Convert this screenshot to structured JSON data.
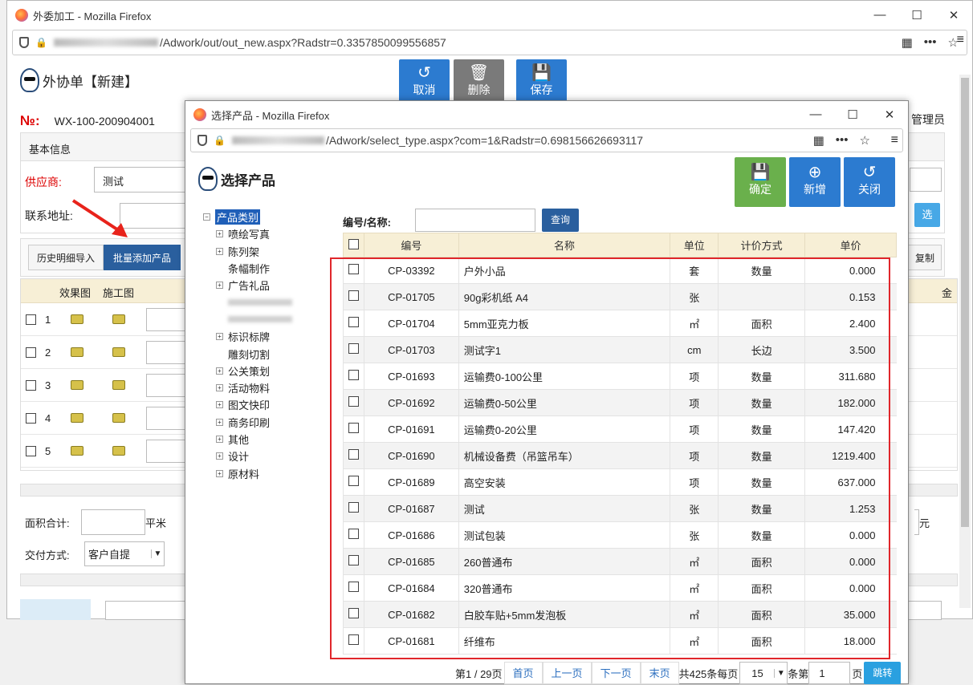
{
  "outer": {
    "window_title": "外委加工 - Mozilla Firefox",
    "url_visible": "/Adwork/out/out_new.aspx?Radstr=0.3357850099556857",
    "page_title": "外协单【新建】",
    "no_label": "№:",
    "no_value": "WX-100-200904001",
    "toolbar": {
      "cancel": "取消",
      "delete": "删除",
      "save": "保存"
    },
    "user_label": "管理员",
    "basic_info": "基本信息",
    "supplier_label": "供应商:",
    "supplier_value": "测试",
    "address_label": "联系地址:",
    "pick_button": "选",
    "tabs": {
      "history_import": "历史明细导入",
      "batch_add": "批量添加产品",
      "copy": "复制"
    },
    "detail_headers": {
      "effect_img": "效果图",
      "work_img": "施工图",
      "amount_partial": "金"
    },
    "rows": [
      "1",
      "2",
      "3",
      "4",
      "5"
    ],
    "area_total_label": "面积合计:",
    "area_unit": "平米",
    "currency_unit": "元",
    "delivery_label": "交付方式:",
    "delivery_value": "客户自提"
  },
  "popup": {
    "window_title": "选择产品 - Mozilla Firefox",
    "url_visible": "/Adwork/select_type.aspx?com=1&Radstr=0.698156626693117",
    "page_title": "选择产品",
    "buttons": {
      "confirm": "确定",
      "add": "新增",
      "close": "关闭"
    },
    "search_label": "编号/名称:",
    "search_value": "",
    "query_button": "查询",
    "tree_root": "产品类别",
    "tree": [
      {
        "label": "喷绘写真",
        "expandable": true
      },
      {
        "label": "陈列架",
        "expandable": true
      },
      {
        "label": "条幅制作",
        "expandable": false
      },
      {
        "label": "广告礼品",
        "expandable": true
      },
      {
        "label": "",
        "expandable": false
      },
      {
        "label": "",
        "expandable": false
      },
      {
        "label": "标识标牌",
        "expandable": true
      },
      {
        "label": "雕刻切割",
        "expandable": false
      },
      {
        "label": "公关策划",
        "expandable": true
      },
      {
        "label": "活动物料",
        "expandable": true
      },
      {
        "label": "图文快印",
        "expandable": true
      },
      {
        "label": "商务印刷",
        "expandable": true
      },
      {
        "label": "其他",
        "expandable": true
      },
      {
        "label": "设计",
        "expandable": true
      },
      {
        "label": "原材料",
        "expandable": true
      }
    ],
    "columns": [
      "编号",
      "名称",
      "单位",
      "计价方式",
      "单价"
    ],
    "products": [
      {
        "code": "CP-03392",
        "name": "户外小品",
        "unit": "套",
        "pricing": "数量",
        "price": "0.000"
      },
      {
        "code": "CP-01705",
        "name": "90g彩机纸 A4",
        "unit": "张",
        "pricing": "",
        "price": "0.153"
      },
      {
        "code": "CP-01704",
        "name": "5mm亚克力板",
        "unit": "㎡",
        "pricing": "面积",
        "price": "2.400"
      },
      {
        "code": "CP-01703",
        "name": "测试字1",
        "unit": "cm",
        "pricing": "长边",
        "price": "3.500"
      },
      {
        "code": "CP-01693",
        "name": "运输费0-100公里",
        "unit": "项",
        "pricing": "数量",
        "price": "311.680"
      },
      {
        "code": "CP-01692",
        "name": "运输费0-50公里",
        "unit": "项",
        "pricing": "数量",
        "price": "182.000"
      },
      {
        "code": "CP-01691",
        "name": "运输费0-20公里",
        "unit": "项",
        "pricing": "数量",
        "price": "147.420"
      },
      {
        "code": "CP-01690",
        "name": "机械设备费（吊篮吊车）",
        "unit": "项",
        "pricing": "数量",
        "price": "1219.400"
      },
      {
        "code": "CP-01689",
        "name": "高空安装",
        "unit": "项",
        "pricing": "数量",
        "price": "637.000"
      },
      {
        "code": "CP-01687",
        "name": "测试",
        "unit": "张",
        "pricing": "数量",
        "price": "1.253"
      },
      {
        "code": "CP-01686",
        "name": "测试包装",
        "unit": "张",
        "pricing": "数量",
        "price": "0.000"
      },
      {
        "code": "CP-01685",
        "name": "260普通布",
        "unit": "㎡",
        "pricing": "面积",
        "price": "0.000"
      },
      {
        "code": "CP-01684",
        "name": "320普通布",
        "unit": "㎡",
        "pricing": "面积",
        "price": "0.000"
      },
      {
        "code": "CP-01682",
        "name": "白胶车贴+5mm发泡板",
        "unit": "㎡",
        "pricing": "面积",
        "price": "35.000"
      },
      {
        "code": "CP-01681",
        "name": "纤维布",
        "unit": "㎡",
        "pricing": "面积",
        "price": "18.000"
      }
    ],
    "pager": {
      "page_info": "第1 / 29页",
      "first": "首页",
      "prev": "上一页",
      "next": "下一页",
      "last": "末页",
      "total_prefix": "共425条每页",
      "page_size": "15",
      "goto_prefix": "条第",
      "goto_value": "1",
      "goto_suffix": "页",
      "jump": "跳转"
    }
  }
}
